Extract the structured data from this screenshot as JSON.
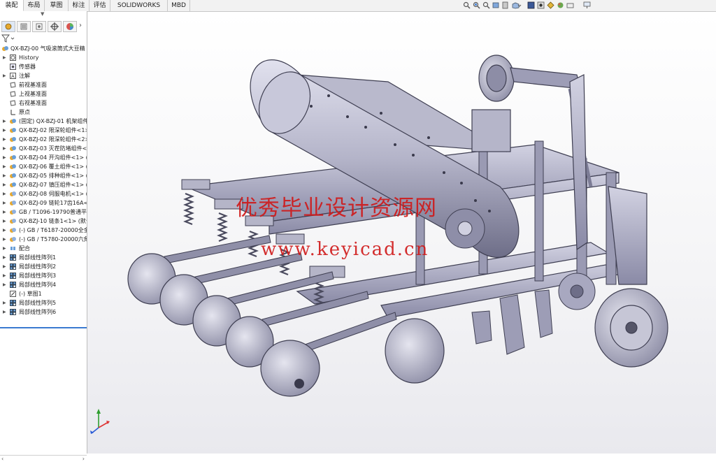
{
  "tabs": [
    {
      "label": "装配体",
      "active": true
    },
    {
      "label": "布局",
      "active": false
    },
    {
      "label": "草图",
      "active": false
    },
    {
      "label": "标注",
      "active": false
    },
    {
      "label": "评估",
      "active": false
    },
    {
      "label": "SOLIDWORKS 插件",
      "active": false
    },
    {
      "label": "MBD",
      "active": false
    }
  ],
  "view_tools": [
    "zoom-to-fit-icon",
    "zoom-to-area-icon",
    "previous-view-icon",
    "section-view-icon",
    "dynamic-annotation-icon",
    "view-orientation-icon",
    "display-style-icon",
    "hide-show-items-icon",
    "edit-appearance-icon",
    "apply-scene-icon",
    "view-settings-icon",
    "monitor-icon"
  ],
  "feature_tree": {
    "root": "QX-BZJ-00 气吸滚筒式大豆精",
    "items": [
      {
        "label": "History",
        "icon": "history-icon",
        "arrow": true
      },
      {
        "label": "传感器",
        "icon": "sensor-icon",
        "arrow": false
      },
      {
        "label": "注解",
        "icon": "annotation-icon",
        "arrow": true
      },
      {
        "label": "前视基准面",
        "icon": "plane-icon",
        "arrow": false
      },
      {
        "label": "上视基准面",
        "icon": "plane-icon",
        "arrow": false
      },
      {
        "label": "右视基准面",
        "icon": "plane-icon",
        "arrow": false
      },
      {
        "label": "原点",
        "icon": "origin-icon",
        "arrow": false
      },
      {
        "label": "(固定) QX-BZJ-01 机架组件",
        "icon": "subassembly-icon",
        "arrow": true
      },
      {
        "label": "QX-BZJ-02 限深轮组件<1>",
        "icon": "subassembly-icon",
        "arrow": true
      },
      {
        "label": "QX-BZJ-02 限深轮组件<2>",
        "icon": "subassembly-icon",
        "arrow": true
      },
      {
        "label": "QX-BZJ-03 灭茬防堵组件<",
        "icon": "subassembly-icon",
        "arrow": true
      },
      {
        "label": "QX-BZJ-04 开沟组件<1> (",
        "icon": "subassembly-icon",
        "arrow": true
      },
      {
        "label": "QX-BZJ-06 覆土组件<1> (",
        "icon": "subassembly-icon",
        "arrow": true
      },
      {
        "label": "QX-BZJ-05 排种组件<1> (",
        "icon": "subassembly-icon",
        "arrow": true
      },
      {
        "label": "QX-BZJ-07 镇压组件<1> (",
        "icon": "subassembly-icon",
        "arrow": true
      },
      {
        "label": "QX-BZJ-08 伺服电机<1> (",
        "icon": "part-icon",
        "arrow": true
      },
      {
        "label": "QX-BZJ-09 链轮17齿16A<",
        "icon": "part-icon",
        "arrow": true
      },
      {
        "label": "GB / T1096-19790普通平",
        "icon": "part-icon",
        "arrow": true
      },
      {
        "label": "QX-BZJ-10 链条1<1> (默认",
        "icon": "part-icon",
        "arrow": true
      },
      {
        "label": "(-) GB / T6187-20000全金",
        "icon": "part-icon",
        "arrow": true
      },
      {
        "label": "(-) GB / T5780-20000六角",
        "icon": "part-icon",
        "arrow": true
      },
      {
        "label": "配合",
        "icon": "mates-icon",
        "arrow": true
      },
      {
        "label": "局部线性阵列1",
        "icon": "pattern-icon",
        "arrow": true
      },
      {
        "label": "局部线性阵列2",
        "icon": "pattern-icon",
        "arrow": true
      },
      {
        "label": "局部线性阵列3",
        "icon": "pattern-icon",
        "arrow": true
      },
      {
        "label": "局部线性阵列4",
        "icon": "pattern-icon",
        "arrow": true
      },
      {
        "label": "(-) 草图1",
        "icon": "sketch-icon",
        "arrow": false
      },
      {
        "label": "局部线性阵列5",
        "icon": "pattern-icon",
        "arrow": true
      },
      {
        "label": "局部线性阵列6",
        "icon": "pattern-icon",
        "arrow": true
      }
    ]
  },
  "watermark": {
    "line1": "优秀毕业设计资源网",
    "line2": "www.keyicad.cn"
  },
  "colors": {
    "model": "#a9a9c2",
    "model_dark": "#4d4d63",
    "watermark": "#d01818",
    "tree_select": "#3a7ad0"
  }
}
